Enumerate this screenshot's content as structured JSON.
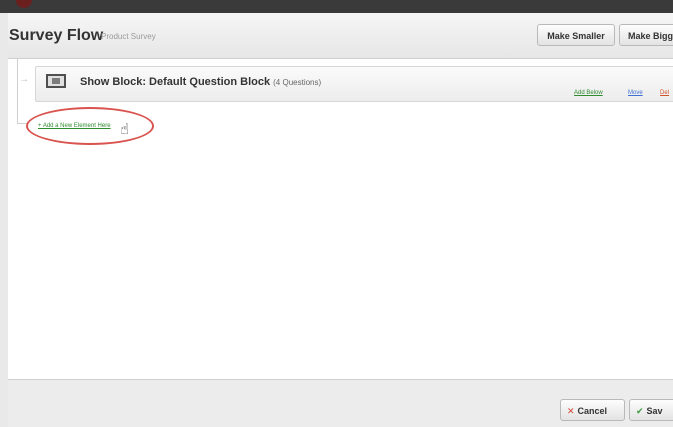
{
  "header": {
    "title": "Survey Flow",
    "subtitle": "Product Survey",
    "make_smaller": "Make Smaller",
    "make_bigger": "Make Bigg"
  },
  "block": {
    "title": "Show Block: Default Question Block",
    "count": "(4 Questions)",
    "add_below": "Add Below",
    "move": "Move",
    "delete": "Del"
  },
  "flow": {
    "add_new_element": "+ Add a New Element Here"
  },
  "footer": {
    "cancel": "Cancel",
    "save": "Sav"
  },
  "colors": {
    "accent_green": "#2e8b2e",
    "link_blue": "#3f6fd1",
    "delete_red": "#d0532a",
    "highlight_red": "#d9534f"
  }
}
